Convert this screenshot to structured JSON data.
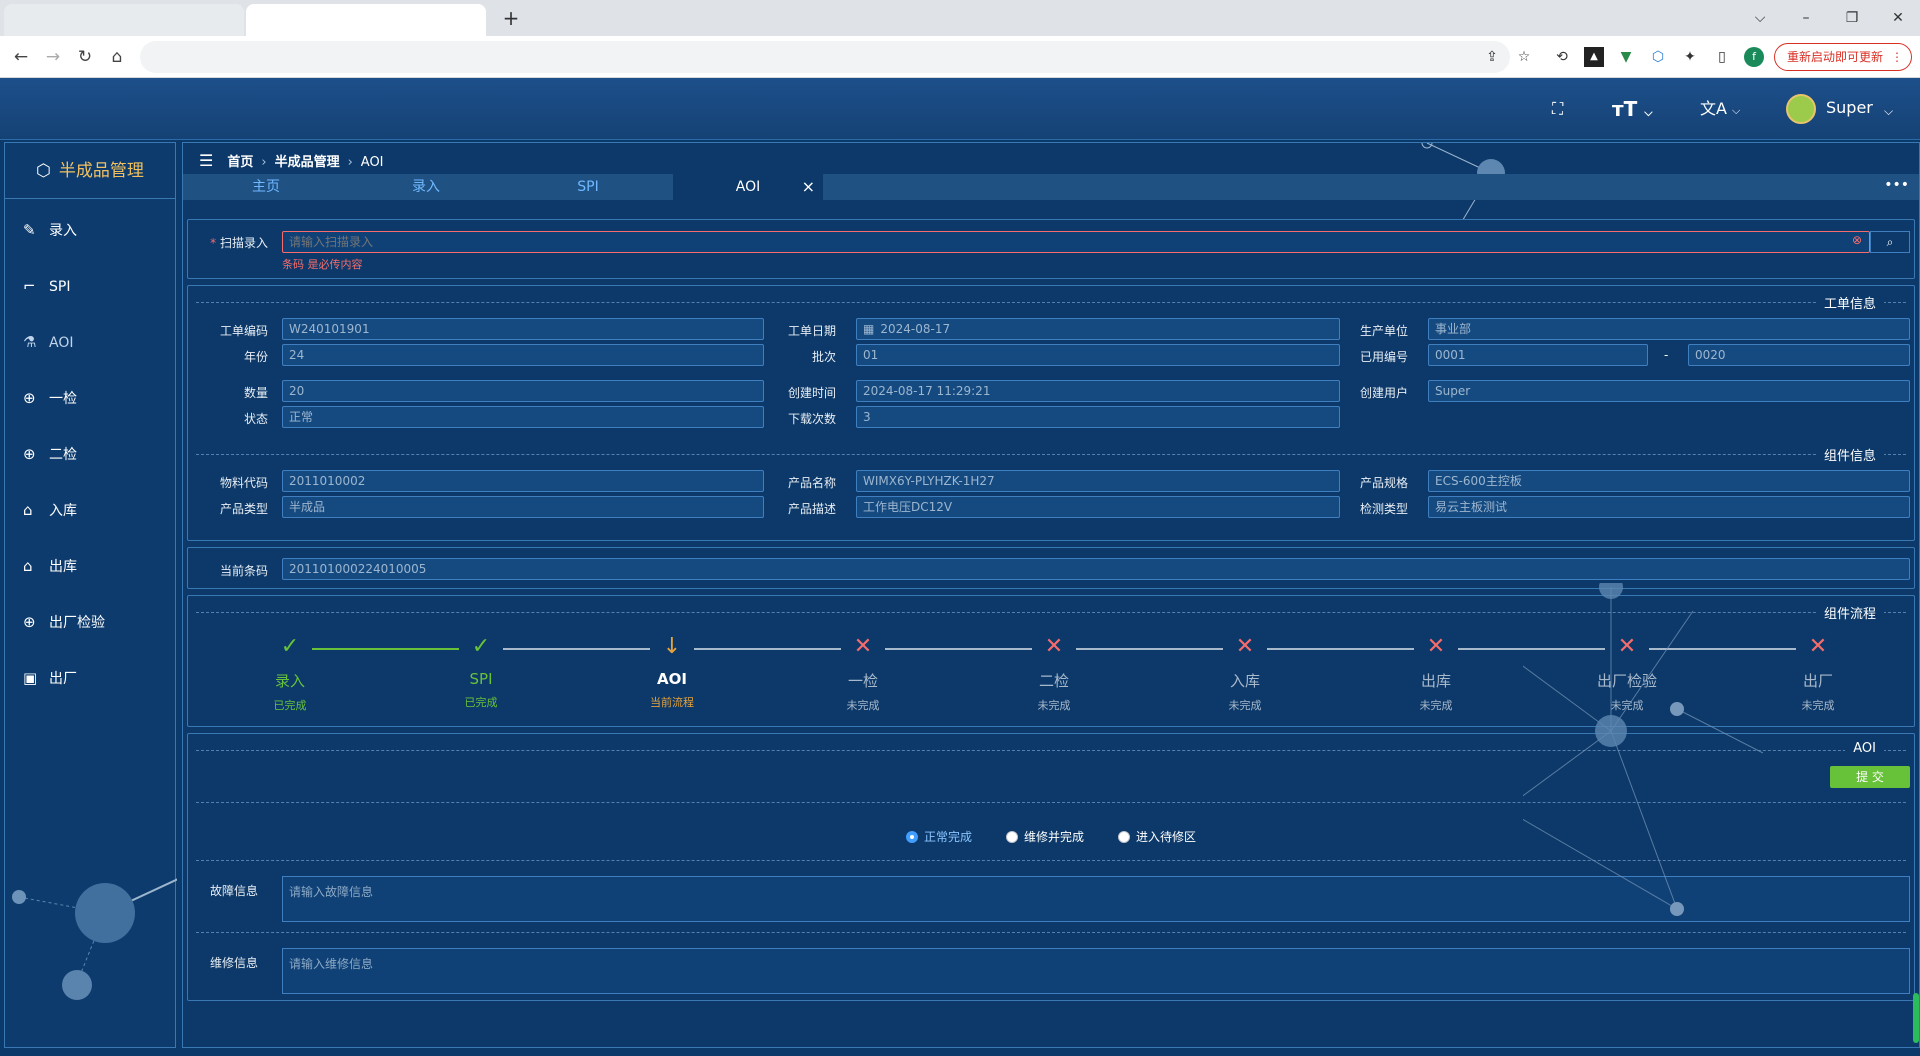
{
  "browser": {
    "new_tab": "+",
    "window_controls": [
      "⌵",
      "–",
      "❐",
      "✕"
    ],
    "nav": [
      "←",
      "→",
      "↻",
      "⌂"
    ],
    "extensions": [
      "⇪",
      "☆",
      "⟲",
      "▲",
      "▼",
      "⬡",
      "✦",
      "▯",
      "f"
    ],
    "update_button": "重新启动即可更新",
    "menu": "⋮"
  },
  "header": {
    "user": "Super"
  },
  "sidebar": {
    "title": "半成品管理",
    "items": [
      {
        "label": "录入",
        "icon": "✎"
      },
      {
        "label": "SPI",
        "icon": "⌐"
      },
      {
        "label": "AOI",
        "icon": "⚗"
      },
      {
        "label": "一检",
        "icon": "⊕"
      },
      {
        "label": "二检",
        "icon": "⊕"
      },
      {
        "label": "入库",
        "icon": "⌂"
      },
      {
        "label": "出库",
        "icon": "⌂"
      },
      {
        "label": "出厂检验",
        "icon": "⊕"
      },
      {
        "label": "出厂",
        "icon": "▣"
      }
    ]
  },
  "breadcrumb": {
    "home": "首页",
    "section": "半成品管理",
    "current": "AOI"
  },
  "tabs": [
    {
      "label": "主页"
    },
    {
      "label": "录入"
    },
    {
      "label": "SPI"
    },
    {
      "label": "AOI",
      "close": "×"
    }
  ],
  "scan": {
    "label": "扫描录入",
    "required": "*",
    "placeholder": "请输入扫描录入",
    "error": "条码 是必传内容"
  },
  "order": {
    "title": "工单信息",
    "fields": {
      "code": {
        "label": "工单编码",
        "value": "W240101901"
      },
      "date": {
        "label": "工单日期",
        "value": "2024-08-17"
      },
      "unit": {
        "label": "生产单位",
        "value": "事业部"
      },
      "year": {
        "label": "年份",
        "value": "24"
      },
      "batch": {
        "label": "批次",
        "value": "01"
      },
      "used": {
        "label": "已用编号",
        "value": "0001",
        "value2": "0020",
        "dash": "-"
      },
      "qty": {
        "label": "数量",
        "value": "20"
      },
      "created": {
        "label": "创建时间",
        "value": "2024-08-17 11:29:21"
      },
      "creator": {
        "label": "创建用户",
        "value": "Super"
      },
      "status": {
        "label": "状态",
        "value": "正常"
      },
      "downloads": {
        "label": "下载次数",
        "value": "3"
      }
    }
  },
  "component": {
    "title": "组件信息",
    "fields": {
      "material": {
        "label": "物料代码",
        "value": "2011010002"
      },
      "pname": {
        "label": "产品名称",
        "value": "WIMX6Y-PLYHZK-1H27"
      },
      "spec": {
        "label": "产品规格",
        "value": "ECS-600主控板"
      },
      "ptype": {
        "label": "产品类型",
        "value": "半成品"
      },
      "desc": {
        "label": "产品描述",
        "value": "工作电压DC12V"
      },
      "check": {
        "label": "检测类型",
        "value": "易云主板测试"
      }
    }
  },
  "barcode": {
    "label": "当前条码",
    "value": "201101000224010005"
  },
  "flow": {
    "title": "组件流程",
    "steps": [
      {
        "name": "录入",
        "status": "已完成",
        "state": "done"
      },
      {
        "name": "SPI",
        "status": "已完成",
        "state": "done"
      },
      {
        "name": "AOI",
        "status": "当前流程",
        "state": "current"
      },
      {
        "name": "一检",
        "status": "未完成",
        "state": "todo"
      },
      {
        "name": "二检",
        "status": "未完成",
        "state": "todo"
      },
      {
        "name": "入库",
        "status": "未完成",
        "state": "todo"
      },
      {
        "name": "出库",
        "status": "未完成",
        "state": "todo"
      },
      {
        "name": "出厂检验",
        "status": "未完成",
        "state": "todo"
      },
      {
        "name": "出厂",
        "status": "未完成",
        "state": "todo"
      }
    ],
    "marks": {
      "done": "✓",
      "current": "↓",
      "todo": "✕"
    },
    "colors": {
      "done": "#67c23a",
      "current": "#e6a23c",
      "todo": "#f56c6c"
    }
  },
  "aoi": {
    "title": "AOI",
    "submit": "提 交",
    "options": [
      {
        "label": "正常完成",
        "checked": true
      },
      {
        "label": "维修并完成",
        "checked": false
      },
      {
        "label": "进入待修区",
        "checked": false
      }
    ],
    "fault": {
      "label": "故障信息",
      "placeholder": "请输入故障信息"
    },
    "repair": {
      "label": "维修信息",
      "placeholder": "请输入维修信息"
    }
  }
}
